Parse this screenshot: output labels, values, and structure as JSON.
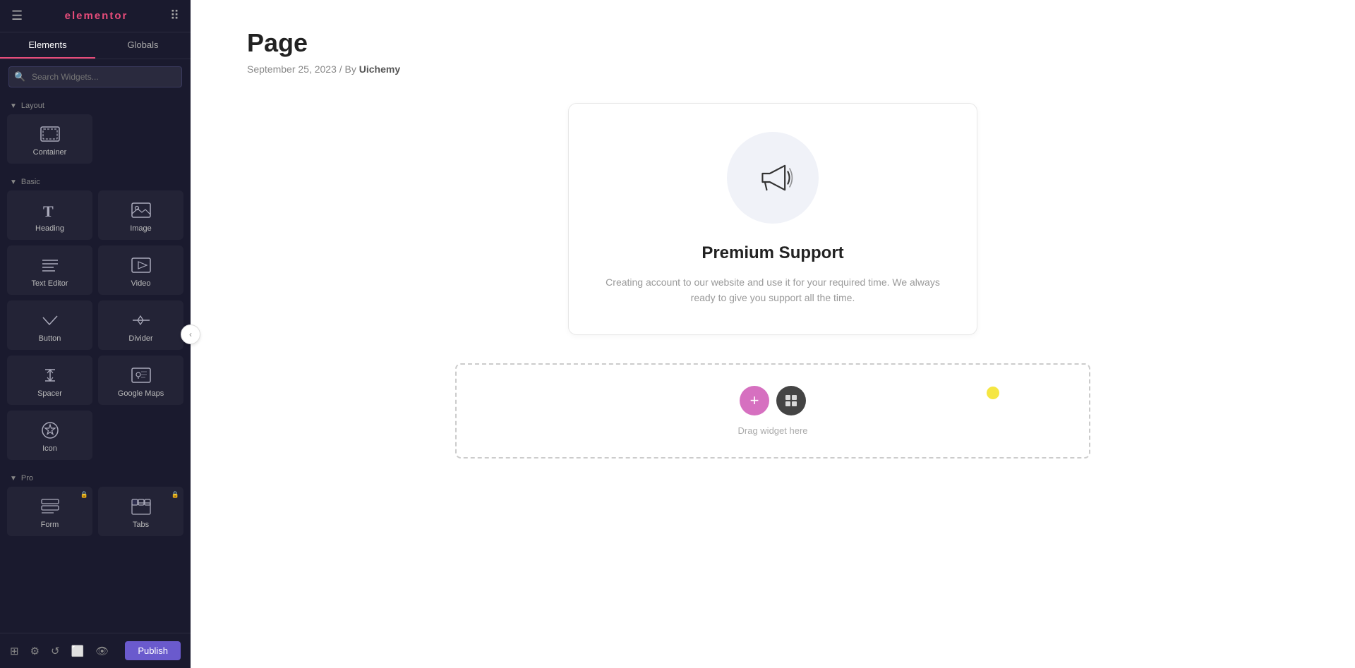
{
  "sidebar": {
    "logo": "elementor",
    "tabs": [
      {
        "id": "elements",
        "label": "Elements",
        "active": true
      },
      {
        "id": "globals",
        "label": "Globals",
        "active": false
      }
    ],
    "search": {
      "placeholder": "Search Widgets..."
    },
    "sections": [
      {
        "id": "layout",
        "label": "Layout",
        "widgets": [
          {
            "id": "container",
            "label": "Container",
            "icon": "container",
            "locked": false
          }
        ]
      },
      {
        "id": "basic",
        "label": "Basic",
        "widgets": [
          {
            "id": "heading",
            "label": "Heading",
            "icon": "heading",
            "locked": false
          },
          {
            "id": "image",
            "label": "Image",
            "icon": "image",
            "locked": false
          },
          {
            "id": "text-editor",
            "label": "Text Editor",
            "icon": "text-editor",
            "locked": false
          },
          {
            "id": "video",
            "label": "Video",
            "icon": "video",
            "locked": false
          },
          {
            "id": "button",
            "label": "Button",
            "icon": "button",
            "locked": false
          },
          {
            "id": "divider",
            "label": "Divider",
            "icon": "divider",
            "locked": false
          },
          {
            "id": "spacer",
            "label": "Spacer",
            "icon": "spacer",
            "locked": false
          },
          {
            "id": "google-maps",
            "label": "Google Maps",
            "icon": "google-maps",
            "locked": false
          },
          {
            "id": "icon",
            "label": "Icon",
            "icon": "icon",
            "locked": false
          }
        ]
      },
      {
        "id": "pro",
        "label": "Pro",
        "widgets": [
          {
            "id": "form",
            "label": "Form",
            "icon": "form",
            "locked": true
          },
          {
            "id": "tabs",
            "label": "Tabs",
            "icon": "tabs",
            "locked": true
          }
        ]
      }
    ],
    "bottom_toolbar": {
      "icons": [
        "layers",
        "settings",
        "history",
        "responsive",
        "eye"
      ],
      "publish_label": "Publish"
    }
  },
  "main": {
    "page_title": "Page",
    "page_meta": "September 25, 2023 / By ",
    "author": "Uichemy",
    "card": {
      "title": "Premium Support",
      "description": "Creating account to our website and use it for your required time. We always ready to give you support all the time."
    },
    "drop_zone": {
      "label": "Drag widget here"
    }
  },
  "collapse_arrow": "‹"
}
